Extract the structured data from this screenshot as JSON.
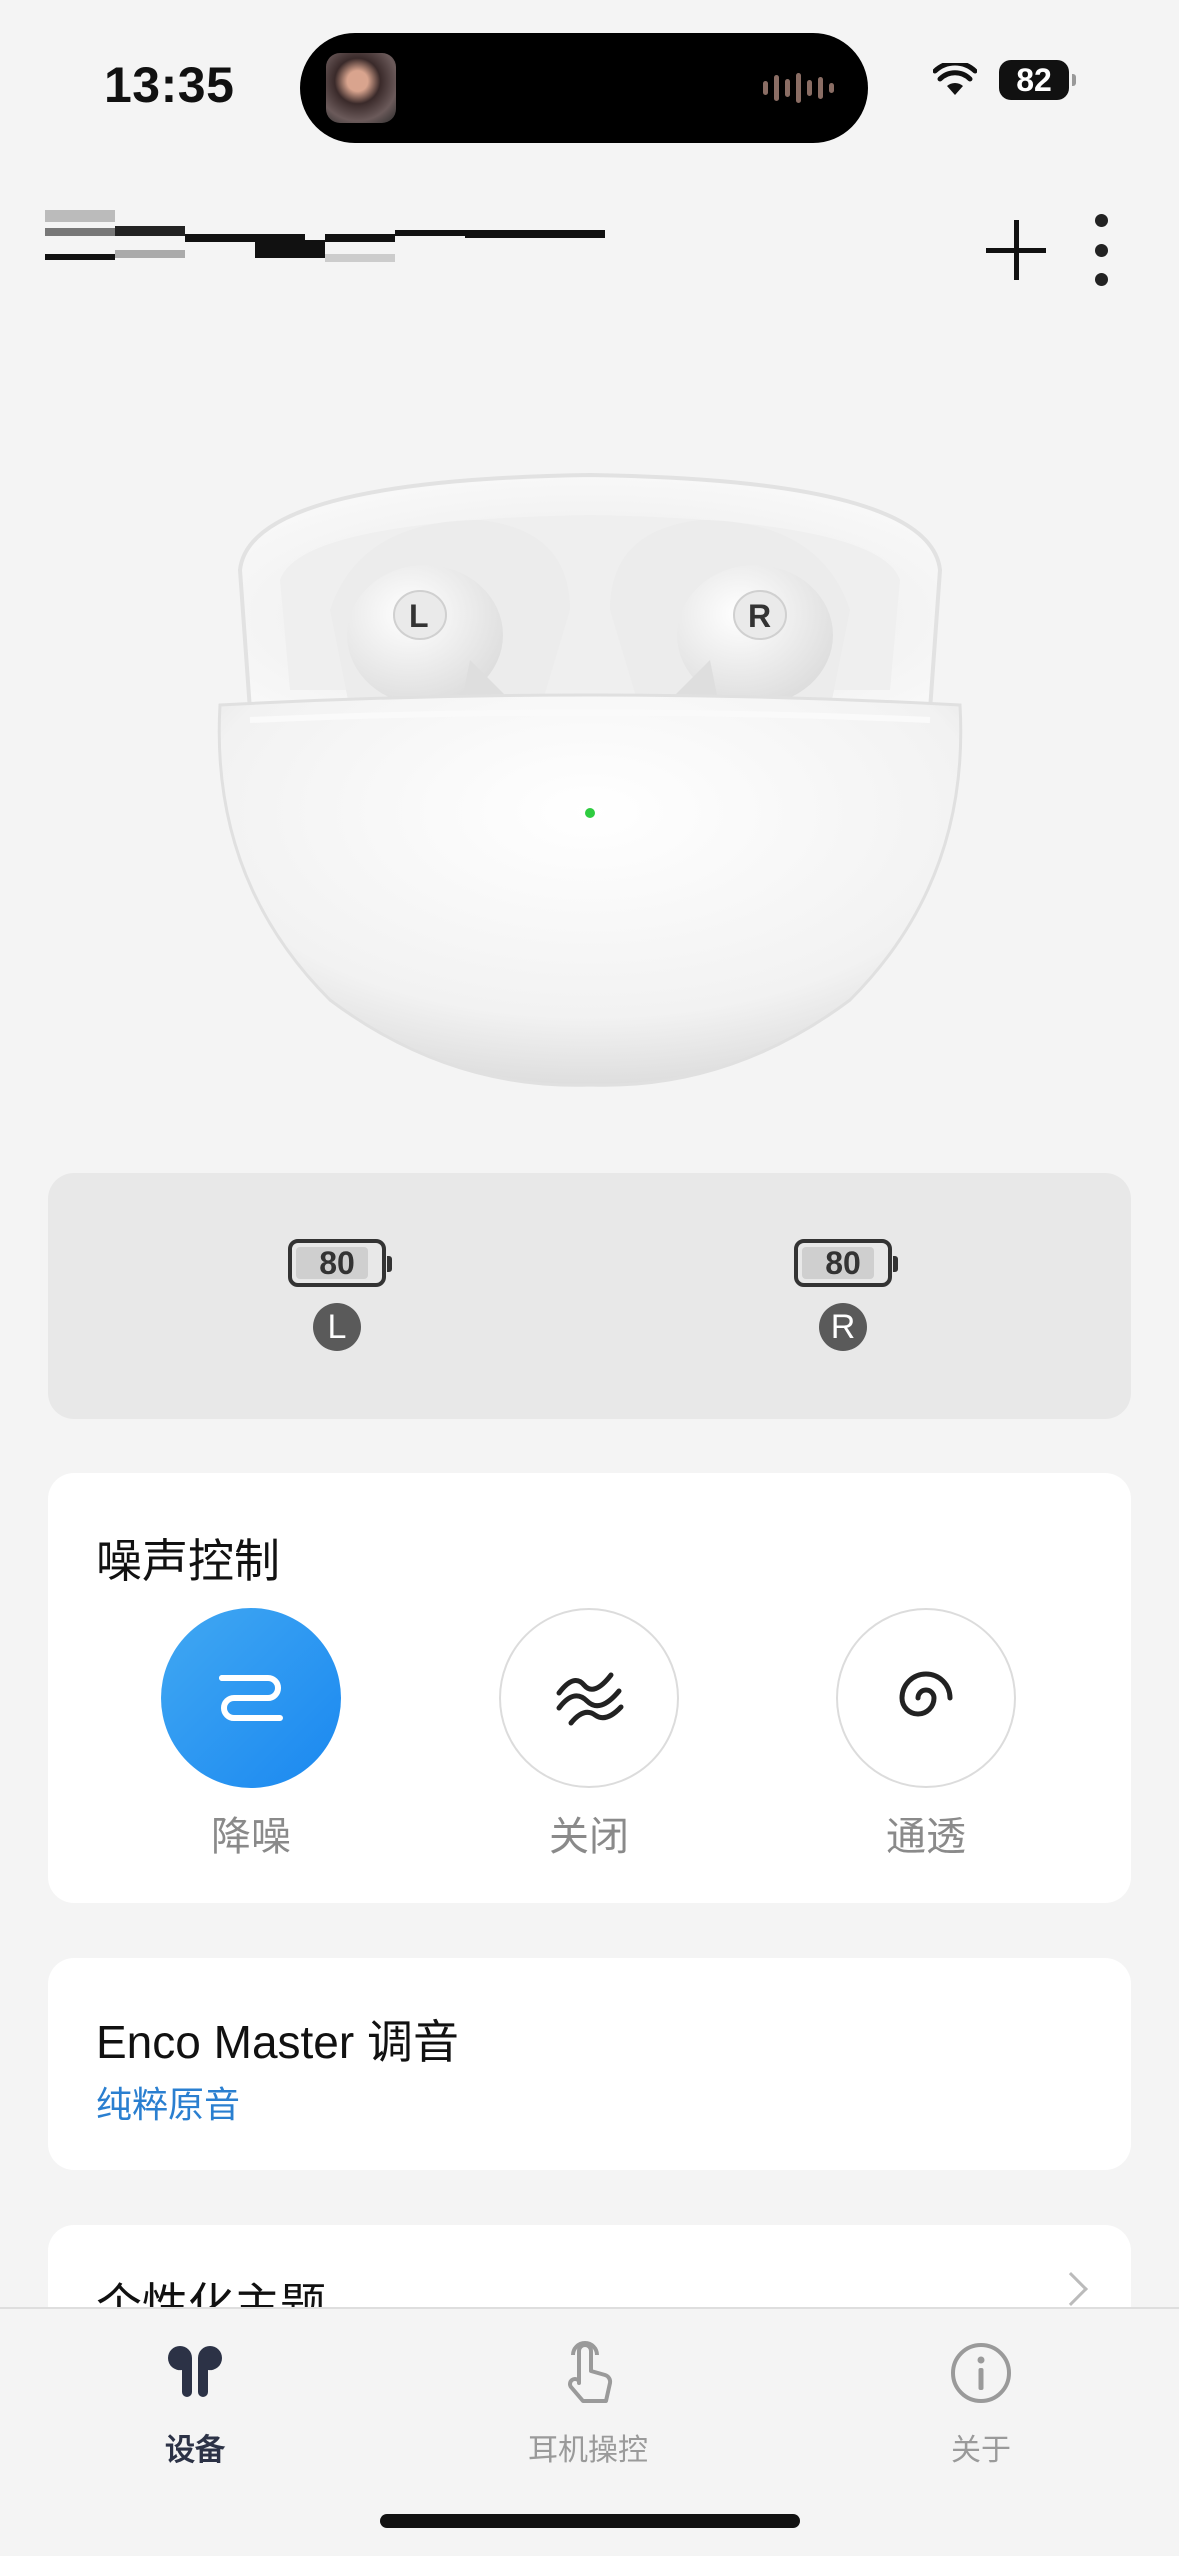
{
  "status_bar": {
    "time": "13:35",
    "battery": "82"
  },
  "header": {
    "add_icon": "plus-icon",
    "more_icon": "more-vertical-icon"
  },
  "battery_status": {
    "left": {
      "value": "80",
      "side": "L"
    },
    "right": {
      "value": "80",
      "side": "R"
    }
  },
  "noise_control": {
    "title": "噪声控制",
    "modes": [
      {
        "label": "降噪",
        "icon": "noise-cancel-icon",
        "active": true
      },
      {
        "label": "关闭",
        "icon": "noise-off-icon",
        "active": false
      },
      {
        "label": "通透",
        "icon": "transparency-icon",
        "active": false
      }
    ]
  },
  "eq": {
    "title": "Enco Master 调音",
    "subtitle": "纯粹原音"
  },
  "theme": {
    "title": "个性化主题"
  },
  "tabs": [
    {
      "label": "设备",
      "icon": "earbuds-icon",
      "active": true
    },
    {
      "label": "耳机操控",
      "icon": "touch-icon",
      "active": false
    },
    {
      "label": "关于",
      "icon": "info-icon",
      "active": false
    }
  ],
  "colors": {
    "accent": "#1a88f0",
    "link": "#2a7fd0",
    "background": "#f4f4f4"
  }
}
